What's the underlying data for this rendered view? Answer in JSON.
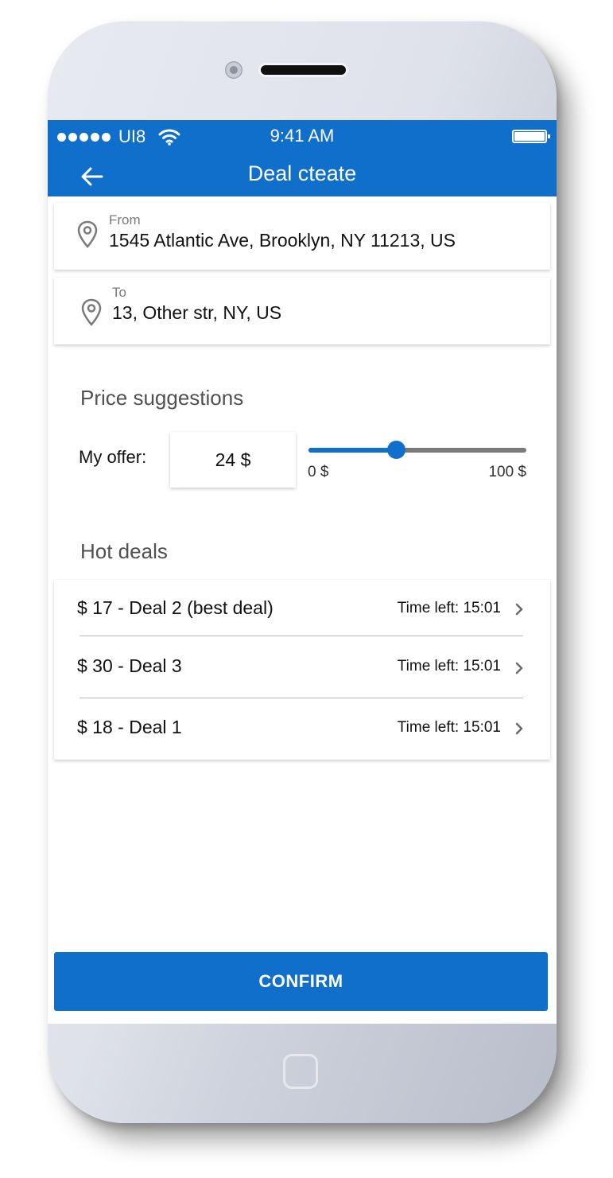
{
  "status_bar": {
    "carrier": "UI8",
    "time": "9:41 AM",
    "signal_icon": "signal-dots-icon",
    "wifi_icon": "wifi-icon",
    "battery_icon": "battery-icon"
  },
  "nav": {
    "title": "Deal cteate",
    "back_icon": "back-arrow-icon"
  },
  "from": {
    "label": "From",
    "value": "1545 Atlantic Ave, Brooklyn, NY 11213, US",
    "icon": "location-pin-icon"
  },
  "to": {
    "label": "To",
    "value": "13, Other str, NY, US",
    "icon": "location-pin-icon"
  },
  "price": {
    "section_title": "Price suggestions",
    "offer_label": "My offer:",
    "offer_value": "24 $",
    "slider_min_label": "0 $",
    "slider_max_label": "100 $",
    "slider_value_fraction": 0.4
  },
  "hot_deals": {
    "section_title": "Hot deals",
    "items": [
      {
        "title": "$ 17 - Deal 2 (best deal)",
        "time_left": "Time left: 15:01"
      },
      {
        "title": "$ 30 - Deal 3",
        "time_left": "Time left: 15:01"
      },
      {
        "title": "$ 18 - Deal 1",
        "time_left": "Time left: 15:01"
      }
    ]
  },
  "confirm": {
    "label": "CONFIRM"
  },
  "colors": {
    "primary": "#0f6fca",
    "slider_track": "#7a7a7a",
    "section_title": "#505050"
  }
}
